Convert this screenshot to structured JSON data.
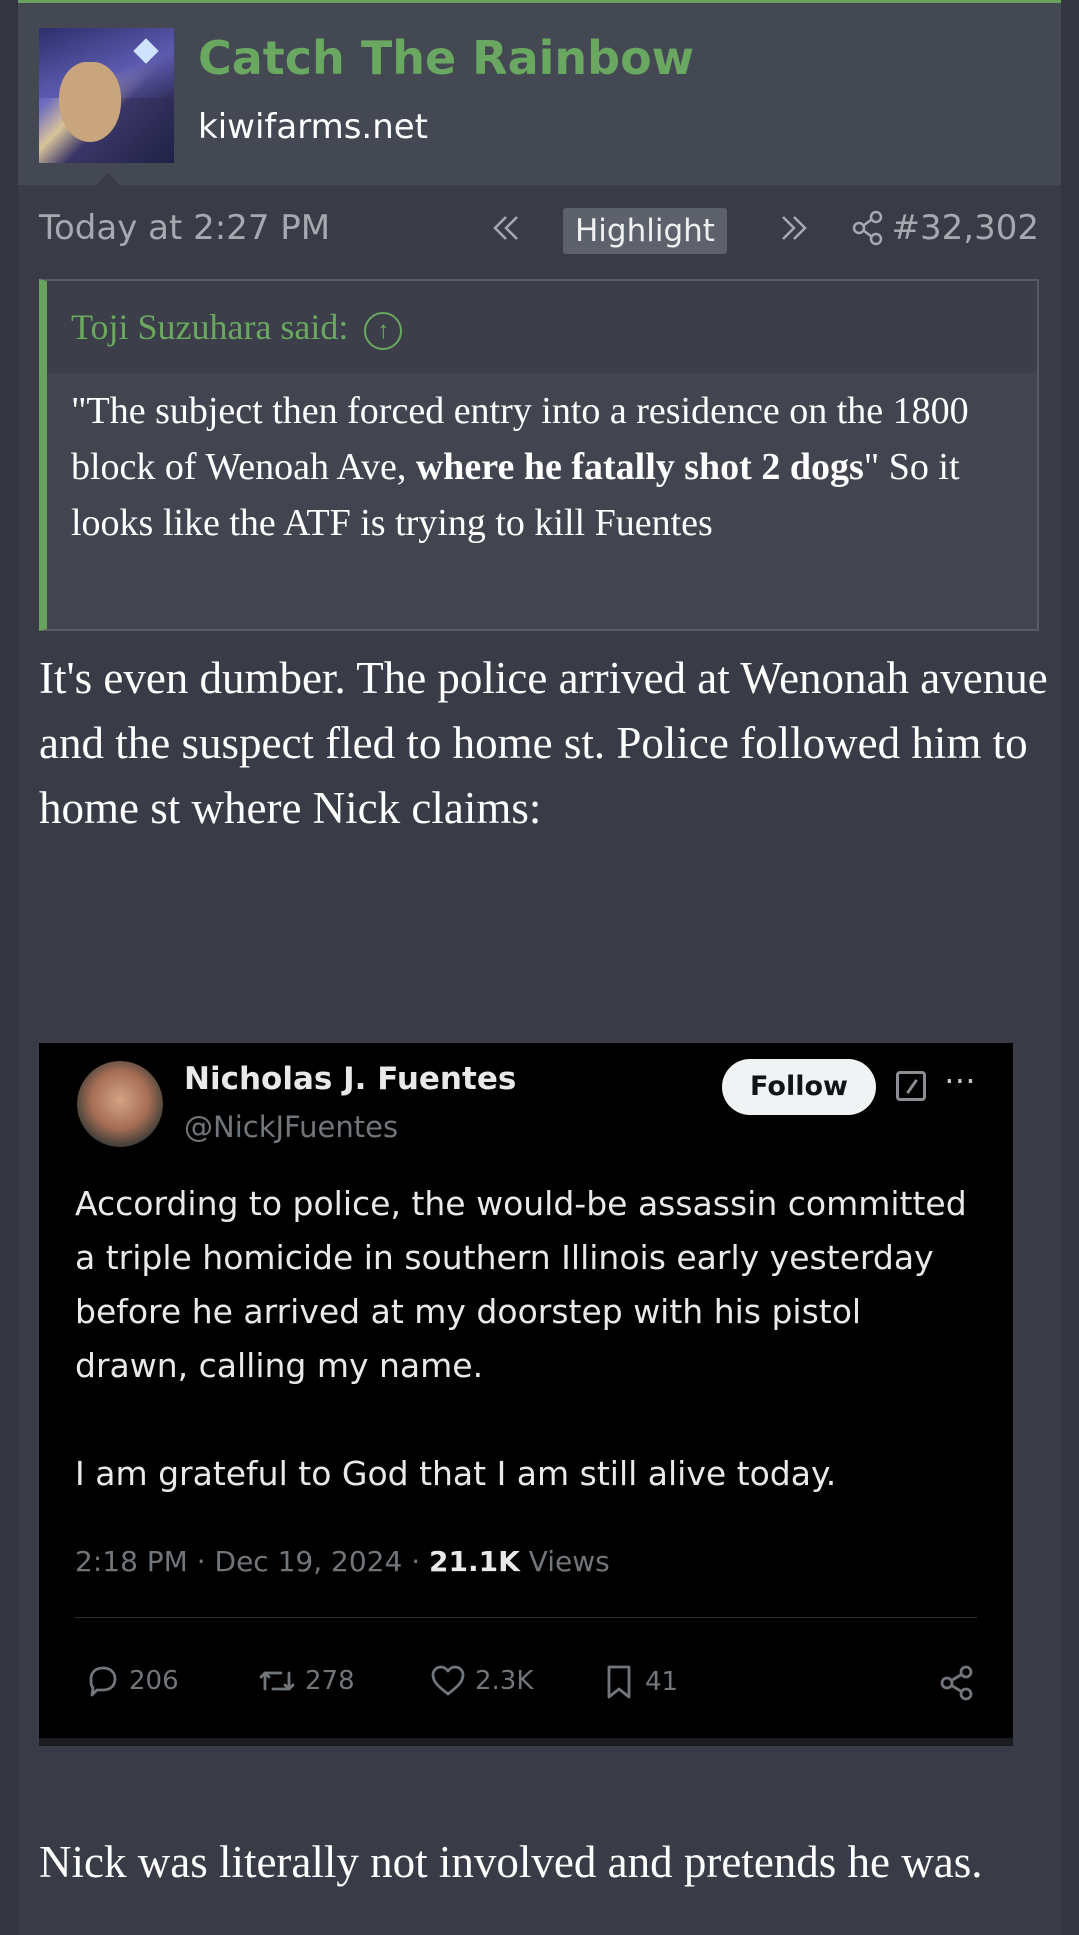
{
  "post": {
    "author": "Catch The Rainbow",
    "site": "kiwifarms.net",
    "timestamp": "Today at 2:27 PM",
    "highlight_label": "Highlight",
    "post_number": "#32,302"
  },
  "quote": {
    "attribution": "Toji Suzuhara said:",
    "text_part1": "\"The subject then forced entry into a residence on the 1800 block of Wenoah Ave, ",
    "text_bold": "where he fatally shot 2 dogs",
    "text_part2": "\" So it looks like the ATF is trying to kill Fuentes"
  },
  "reply": {
    "text": "It's even dumber. The police arrived at Wenonah avenue and the suspect fled to home st. Police followed him to home st where Nick claims:"
  },
  "tweet": {
    "name": "Nicholas J. Fuentes",
    "handle": "@NickJFuentes",
    "follow_label": "Follow",
    "text_p1": "According to police, the would-be assassin committed a triple homicide in southern Illinois early yesterday before he arrived at my doorstep with his pistol drawn, calling my name.",
    "text_p2": "I am grateful to God that I am still alive today.",
    "time": "2:18 PM · Dec 19, 2024 · ",
    "views_count": "21.1K",
    "views_label": " Views",
    "replies": "206",
    "reposts": "278",
    "likes": "2.3K",
    "bookmarks": "41"
  },
  "trailing": {
    "text": "Nick was literally not involved and pretends he was."
  },
  "colors": {
    "accent_green": "#69a25f",
    "background": "#393c46",
    "header": "#444852"
  }
}
